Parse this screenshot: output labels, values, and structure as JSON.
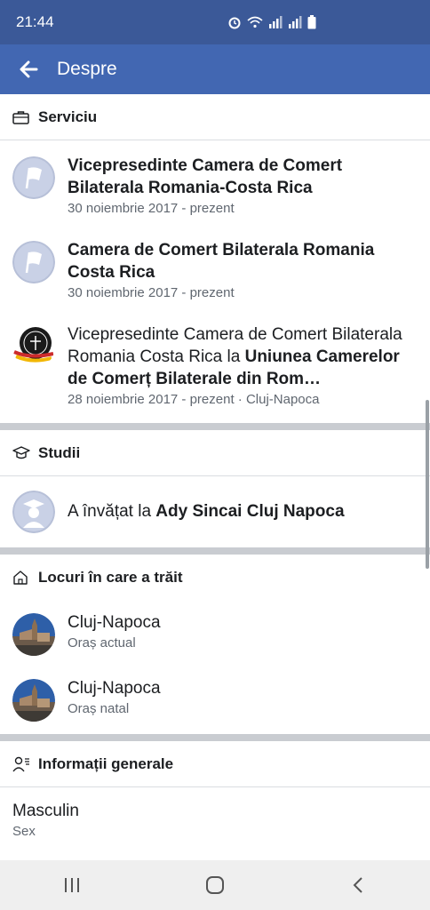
{
  "status_bar": {
    "time": "21:44"
  },
  "app_bar": {
    "title": "Despre"
  },
  "work": {
    "header": "Serviciu",
    "items": [
      {
        "title": "Vicepresedinte Camera de Comert Bilaterala Romania-Costa Rica",
        "subtitle": "30 noiembrie 2017 - prezent"
      },
      {
        "title": "Camera de Comert Bilaterala Romania Costa Rica",
        "subtitle": "30 noiembrie 2017 - prezent"
      },
      {
        "title_prefix": "Vicepresedinte Camera de Comert Bilaterala Romania Costa Rica la ",
        "title_bold": "Uniunea Camerelor de Comerț Bilaterale din Rom…",
        "subtitle": "28 noiembrie 2017 - prezent · Cluj-Napoca"
      }
    ]
  },
  "education": {
    "header": "Studii",
    "item": {
      "prefix": "A învățat la ",
      "school": "Ady Sincai Cluj Napoca"
    }
  },
  "places": {
    "header": "Locuri în care a trăit",
    "items": [
      {
        "city": "Cluj-Napoca",
        "type": "Oraș actual"
      },
      {
        "city": "Cluj-Napoca",
        "type": "Oraș natal"
      }
    ]
  },
  "general": {
    "header": "Informații generale",
    "gender": {
      "value": "Masculin",
      "label": "Sex"
    }
  },
  "colors": {
    "statusbar": "#3b5998",
    "appbar": "#4267b2",
    "divider": "#c9ccd1",
    "placeholder_avatar": "#c9d1e6"
  }
}
